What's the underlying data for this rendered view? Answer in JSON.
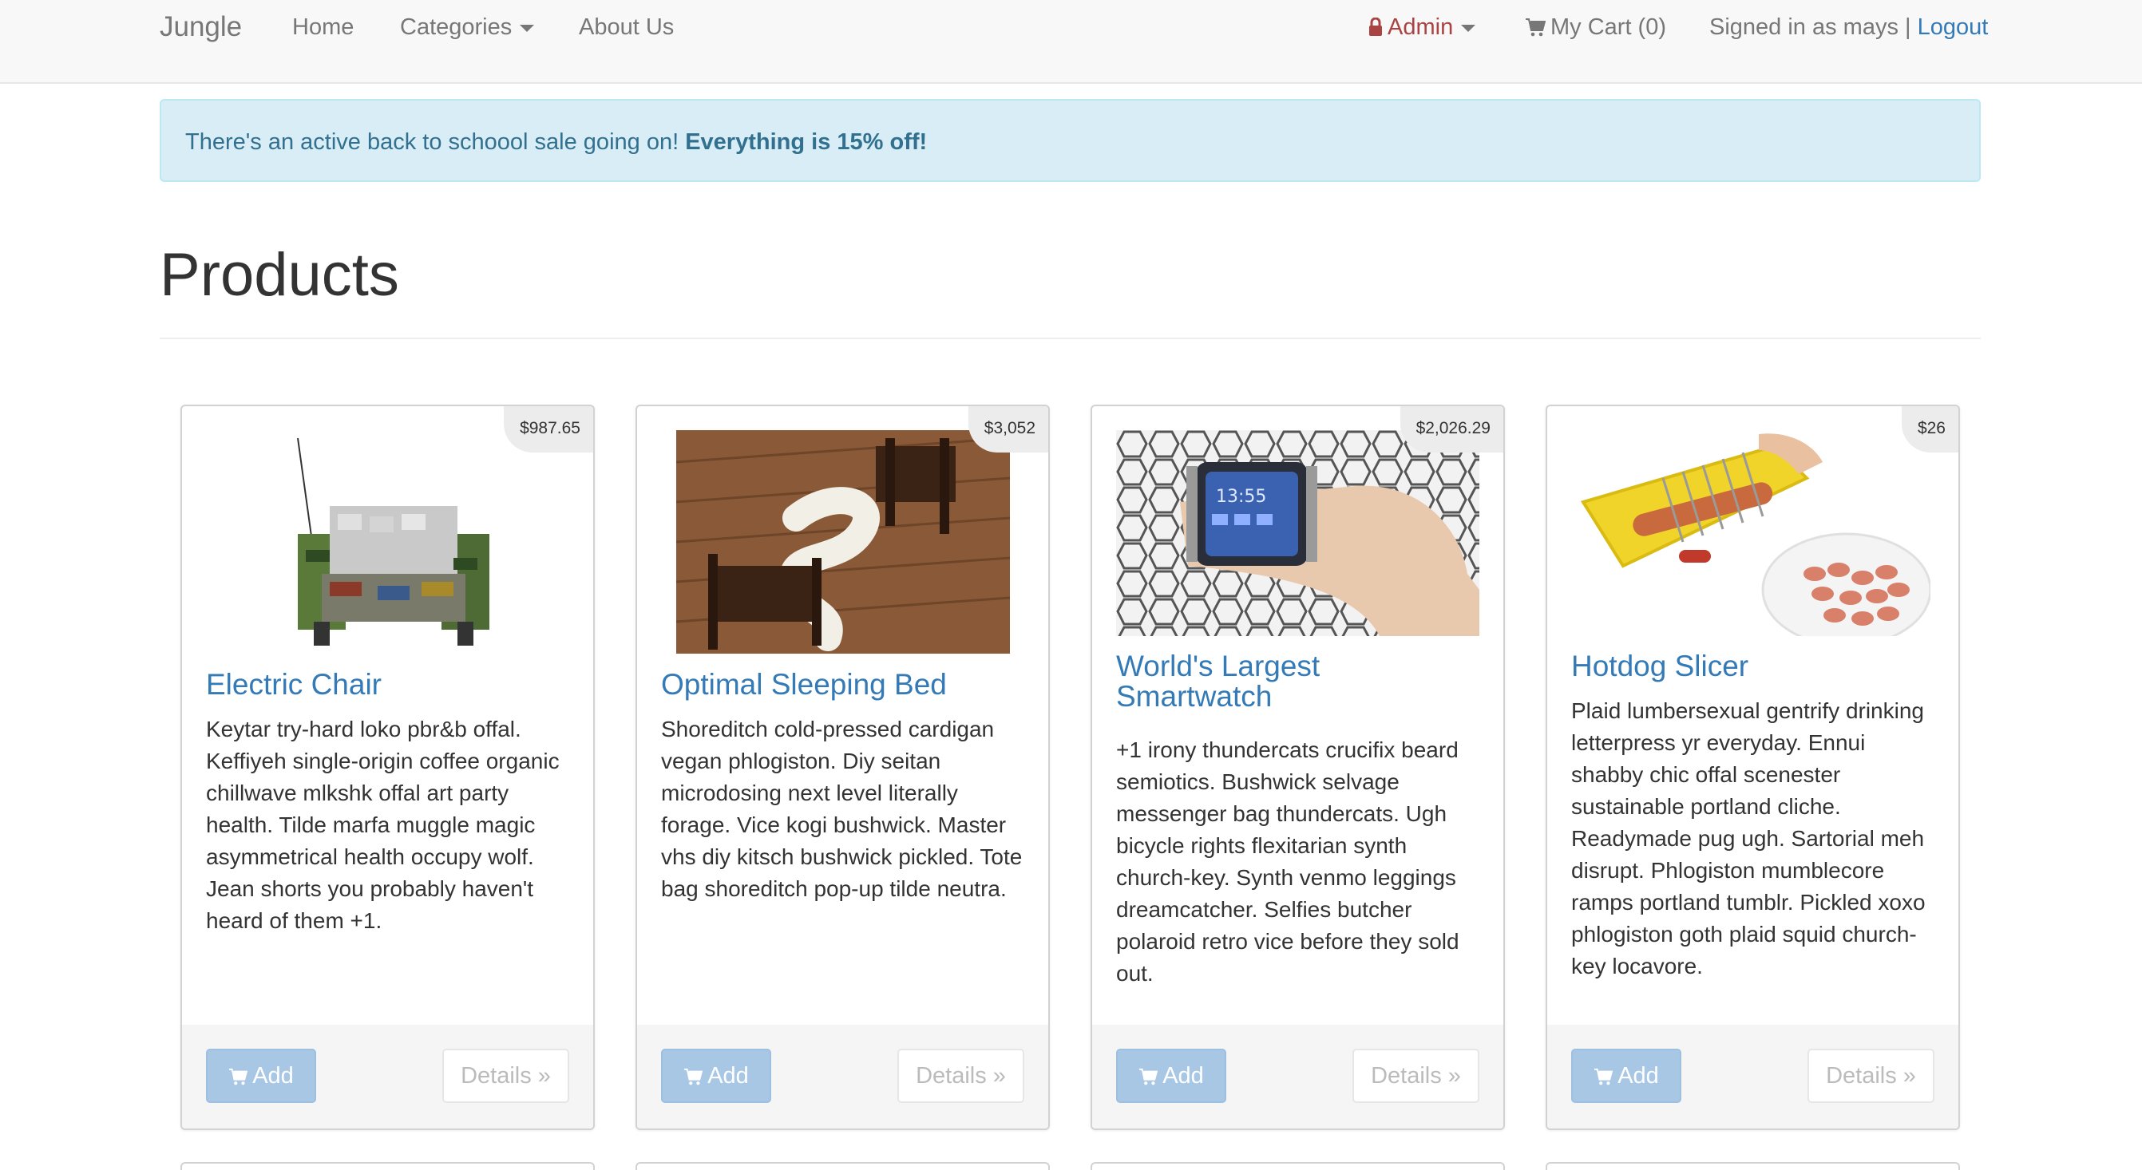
{
  "nav": {
    "brand": "Jungle",
    "home": "Home",
    "categories": "Categories",
    "about": "About Us",
    "admin": "Admin",
    "cart": "My Cart (0)",
    "signed_in": "Signed in as mays |",
    "logout": "Logout",
    "icons": {
      "admin": "lock-icon",
      "cart": "shopping-cart-icon"
    },
    "colors": {
      "admin": "#a94442",
      "link": "#337ab7"
    }
  },
  "alert": {
    "message": "There's an active back to schoool sale going on!",
    "emphasis": "Everything is 15% off!"
  },
  "page": {
    "title": "Products"
  },
  "products": [
    {
      "name": "Electric Chair",
      "price": "$987.65",
      "description": "Keytar try-hard loko pbr&b offal. Keffiyeh single-origin coffee organic chillwave mlkshk offal art party health. Tilde marfa muggle magic asymmetrical health occupy wolf. Jean shorts you probably haven't heard of them +1.",
      "add_label": "Add",
      "details_label": "Details »"
    },
    {
      "name": "Optimal Sleeping Bed",
      "price": "$3,052",
      "description": "Shoreditch cold-pressed cardigan vegan phlogiston. Diy seitan microdosing next level literally forage. Vice kogi bushwick. Master vhs diy kitsch bushwick pickled. Tote bag shoreditch pop-up tilde neutra.",
      "add_label": "Add",
      "details_label": "Details »"
    },
    {
      "name": "World's Largest Smartwatch",
      "price": "$2,026.29",
      "description": "+1 irony thundercats crucifix beard semiotics. Bushwick selvage messenger bag thundercats. Ugh bicycle rights flexitarian synth church-key. Synth venmo leggings dreamcatcher. Selfies butcher polaroid retro vice before they sold out.",
      "add_label": "Add",
      "details_label": "Details »"
    },
    {
      "name": "Hotdog Slicer",
      "price": "$26",
      "description": "Plaid lumbersexual gentrify drinking letterpress yr everyday. Ennui shabby chic offal scenester sustainable portland cliche. Readymade pug ugh. Sartorial meh disrupt. Phlogiston mumblecore ramps portland tumblr. Pickled xoxo phlogiston goth plaid squid church-key locavore.",
      "add_label": "Add",
      "details_label": "Details »"
    }
  ]
}
